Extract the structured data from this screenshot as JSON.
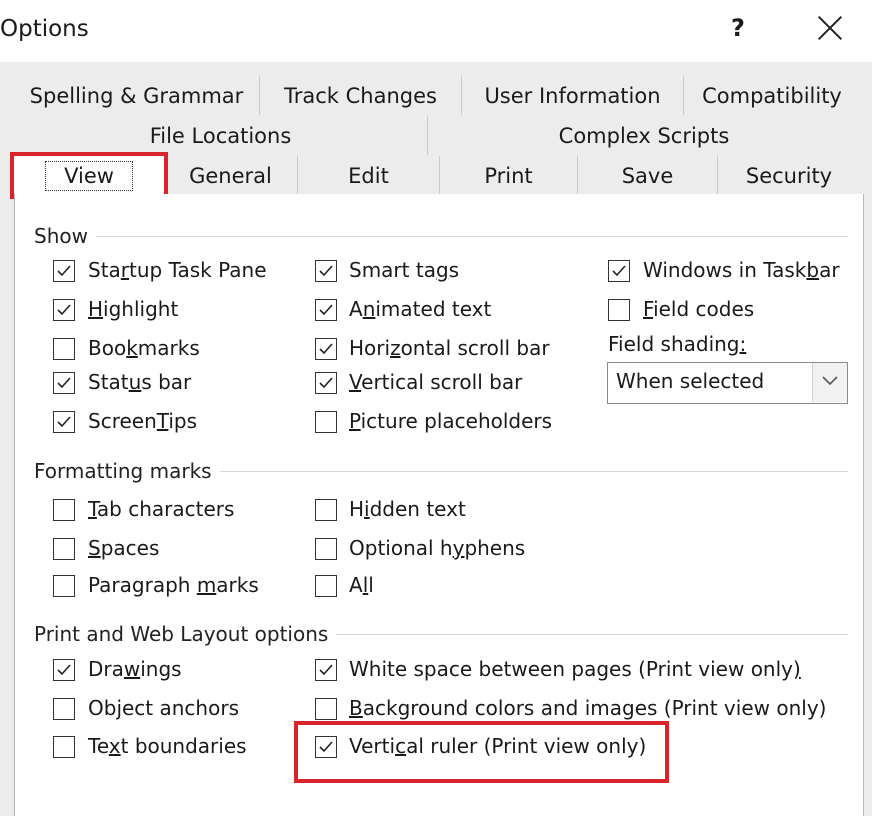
{
  "window": {
    "title": "Options",
    "help_label": "?",
    "close_label": "×"
  },
  "tabs": {
    "row1": [
      "Spelling & Grammar",
      "Track Changes",
      "User Information",
      "Compatibility"
    ],
    "row2": [
      "File Locations",
      "Complex Scripts"
    ],
    "row3": [
      "View",
      "General",
      "Edit",
      "Print",
      "Save",
      "Security"
    ],
    "active": "View"
  },
  "show": {
    "title": "Show",
    "items": [
      {
        "pre": "Sta",
        "u": "r",
        "post": "tup Task Pane",
        "checked": true
      },
      {
        "pre": "",
        "u": "H",
        "post": "ighlight",
        "checked": true
      },
      {
        "pre": "Boo",
        "u": "k",
        "post": "marks",
        "checked": false
      },
      {
        "pre": "Stat",
        "u": "u",
        "post": "s bar",
        "checked": true
      },
      {
        "pre": "Screen",
        "u": "T",
        "post": "ips",
        "checked": true
      },
      {
        "pre": "Smart ta",
        "u": "g",
        "post": "s",
        "checked": true
      },
      {
        "pre": "A",
        "u": "n",
        "post": "imated text",
        "checked": true
      },
      {
        "pre": "Hori",
        "u": "z",
        "post": "ontal scroll bar",
        "checked": true
      },
      {
        "pre": "",
        "u": "V",
        "post": "ertical scroll bar",
        "checked": true
      },
      {
        "pre": "",
        "u": "P",
        "post": "icture placeholders",
        "checked": false
      },
      {
        "pre": "Windows in Task",
        "u": "b",
        "post": "ar",
        "checked": true
      },
      {
        "pre": "",
        "u": "F",
        "post": "ield codes",
        "checked": false
      }
    ],
    "field_shading_label_pre": "Field shading",
    "field_shading_label_u": ":",
    "field_shading_value": "When selected"
  },
  "formatting": {
    "title": "Formatting marks",
    "items": [
      {
        "pre": "",
        "u": "T",
        "post": "ab characters",
        "checked": false
      },
      {
        "pre": "",
        "u": "S",
        "post": "paces",
        "checked": false
      },
      {
        "pre": "Paragraph ",
        "u": "m",
        "post": "arks",
        "checked": false
      },
      {
        "pre": "H",
        "u": "i",
        "post": "dden text",
        "checked": false
      },
      {
        "pre": "Optional h",
        "u": "y",
        "post": "phens",
        "checked": false
      },
      {
        "pre": "A",
        "u": "l",
        "post": "l",
        "checked": false
      }
    ]
  },
  "print_web": {
    "title": "Print and Web Layout options",
    "items": [
      {
        "pre": "Dra",
        "u": "w",
        "post": "ings",
        "checked": true
      },
      {
        "pre": "Ob",
        "u": "j",
        "post": "ect anchors",
        "checked": false
      },
      {
        "pre": "Te",
        "u": "x",
        "post": "t boundaries",
        "checked": false
      },
      {
        "pre": "White space between pages (Print view only",
        "u": ")",
        "post": "",
        "checked": true
      },
      {
        "pre": "",
        "u": "B",
        "post": "ackground colors and images (Print view only)",
        "checked": false
      },
      {
        "pre": "Verti",
        "u": "c",
        "post": "al ruler (Print view only)",
        "checked": true
      }
    ]
  },
  "colors": {
    "highlight_red": "#d9242b",
    "panel_bg": "#ffffff",
    "dialog_bg": "#ececec"
  }
}
